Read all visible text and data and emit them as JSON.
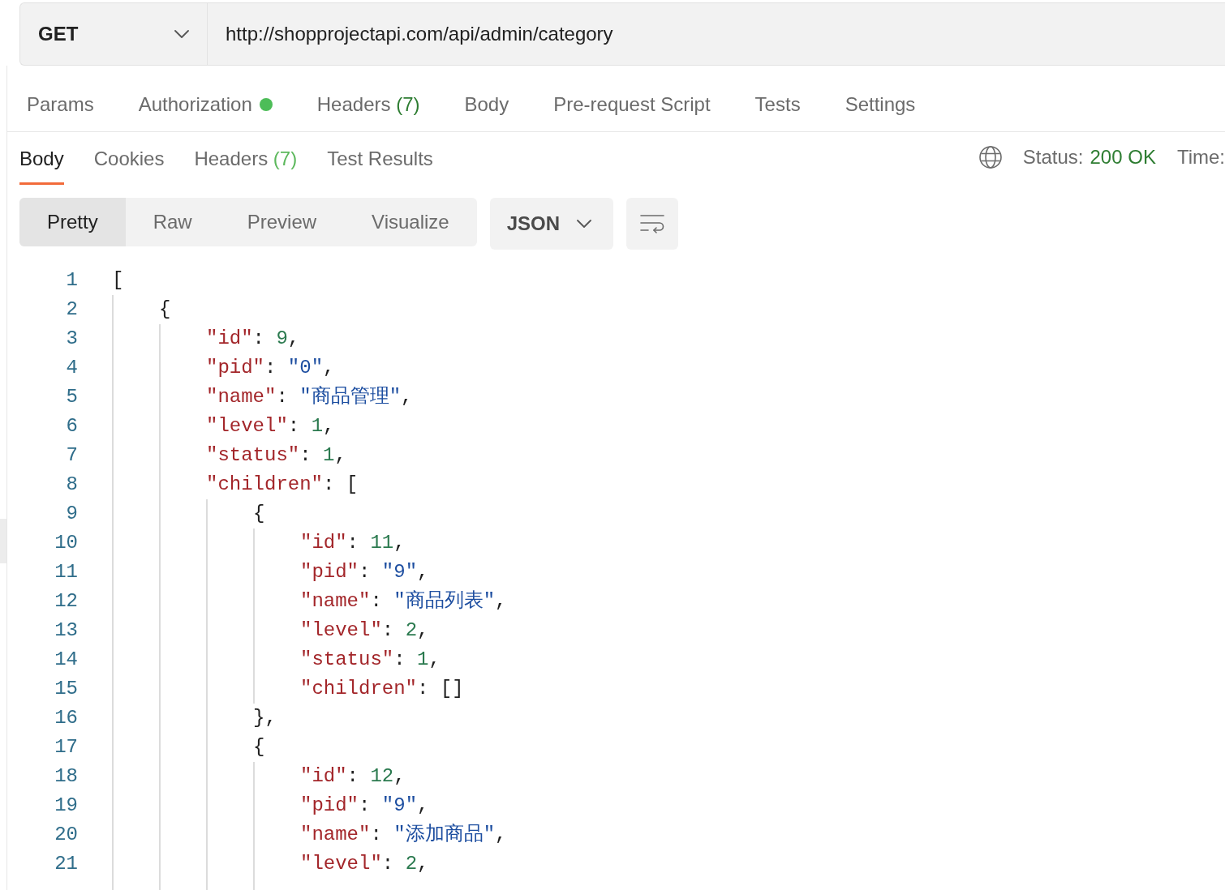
{
  "request": {
    "method": "GET",
    "url": "http://shopprojectapi.com/api/admin/category"
  },
  "request_tabs": [
    {
      "label": "Params",
      "selected": false,
      "indicator": false
    },
    {
      "label": "Authorization",
      "selected": false,
      "indicator": true
    },
    {
      "label": "Headers",
      "count": "(7)",
      "selected": false,
      "indicator": false
    },
    {
      "label": "Body",
      "selected": false,
      "indicator": false
    },
    {
      "label": "Pre-request Script",
      "selected": false,
      "indicator": false
    },
    {
      "label": "Tests",
      "selected": false,
      "indicator": false
    },
    {
      "label": "Settings",
      "selected": false,
      "indicator": false
    }
  ],
  "response_tabs": [
    {
      "label": "Body",
      "selected": true
    },
    {
      "label": "Cookies",
      "selected": false
    },
    {
      "label": "Headers",
      "count": "(7)",
      "selected": false
    },
    {
      "label": "Test Results",
      "selected": false
    }
  ],
  "response_meta": {
    "status_label": "Status:",
    "status_value": "200 OK",
    "time_label": "Time:"
  },
  "view_modes": [
    {
      "label": "Pretty",
      "selected": true
    },
    {
      "label": "Raw",
      "selected": false
    },
    {
      "label": "Preview",
      "selected": false
    },
    {
      "label": "Visualize",
      "selected": false
    }
  ],
  "format": {
    "value": "JSON"
  },
  "code": [
    {
      "number": "1",
      "text": "[",
      "children": [
        {
          "number": "2",
          "text": "{",
          "children": [
            {
              "number": "3",
              "text": "\"id\": 9,"
            },
            {
              "number": "4",
              "text": "\"pid\": \"0\","
            },
            {
              "number": "5",
              "text": "\"name\": \"商品管理\","
            },
            {
              "number": "6",
              "text": "\"level\": 1,"
            },
            {
              "number": "7",
              "text": "\"status\": 1,"
            },
            {
              "number": "8",
              "text": "\"children\": [",
              "children": [
                {
                  "number": "9",
                  "text": "{",
                  "children": [
                    {
                      "number": "10",
                      "text": "\"id\": 11,"
                    },
                    {
                      "number": "11",
                      "text": "\"pid\": \"9\","
                    },
                    {
                      "number": "12",
                      "text": "\"name\": \"商品列表\","
                    },
                    {
                      "number": "13",
                      "text": "\"level\": 2,"
                    },
                    {
                      "number": "14",
                      "text": "\"status\": 1,"
                    },
                    {
                      "number": "15",
                      "text": "\"children\": []"
                    }
                  ]
                },
                {
                  "number": "16",
                  "text": "},"
                },
                {
                  "number": "17",
                  "text": "{",
                  "children": [
                    {
                      "number": "18",
                      "text": "\"id\": 12,"
                    },
                    {
                      "number": "19",
                      "text": "\"pid\": \"9\","
                    },
                    {
                      "number": "20",
                      "text": "\"name\": \"添加商品\","
                    },
                    {
                      "number": "21",
                      "text": "\"level\": 2,"
                    }
                  ]
                }
              ]
            }
          ]
        }
      ]
    }
  ]
}
